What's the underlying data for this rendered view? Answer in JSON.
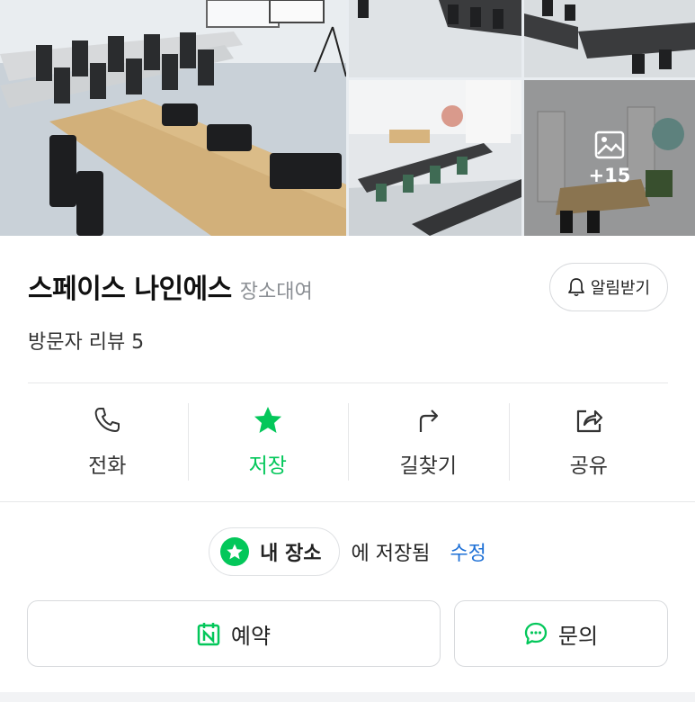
{
  "gallery": {
    "more_count": "+15",
    "more_icon": "image-icon"
  },
  "place": {
    "name": "스페이스 나인에스",
    "category": "장소대여",
    "reviews": "방문자 리뷰 5",
    "notify_label": "알림받기"
  },
  "actions": [
    {
      "label": "전화",
      "icon": "phone-icon"
    },
    {
      "label": "저장",
      "icon": "star-icon",
      "active": true
    },
    {
      "label": "길찾기",
      "icon": "directions-icon"
    },
    {
      "label": "공유",
      "icon": "share-icon"
    }
  ],
  "saved": {
    "chip_label": "내 장소",
    "saved_text": "에 저장됨",
    "edit_label": "수정"
  },
  "buttons": {
    "reserve": "예약",
    "inquiry": "문의"
  },
  "colors": {
    "accent_green": "#03c75a",
    "link_blue": "#1e70d6"
  }
}
